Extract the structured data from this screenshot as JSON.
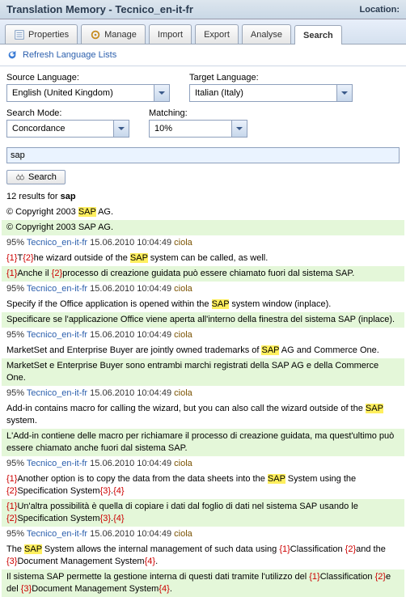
{
  "header": {
    "title": "Translation Memory - Tecnico_en-it-fr",
    "location_label": "Location:"
  },
  "tabs": {
    "properties": "Properties",
    "manage": "Manage",
    "import": "Import",
    "export": "Export",
    "analyse": "Analyse",
    "search": "Search"
  },
  "subtool": {
    "refresh": "Refresh Language Lists"
  },
  "form": {
    "source_label": "Source Language:",
    "source_value": "English (United Kingdom)",
    "target_label": "Target Language:",
    "target_value": "Italian (Italy)",
    "mode_label": "Search Mode:",
    "mode_value": "Concordance",
    "matching_label": "Matching:",
    "matching_value": "10%"
  },
  "search": {
    "value": "sap",
    "button": "Search"
  },
  "results": {
    "count_prefix": "12 results for ",
    "count_term": "sap",
    "copyright_src": "© Copyright 2003 SAP AG.",
    "copyright_tgt": "© Copyright 2003 SAP AG.",
    "meta1": {
      "pct": "95%",
      "tm": "Tecnico_en-it-fr",
      "ts": "15.06.2010 10:04:49",
      "user": "ciola"
    },
    "src1_a": "T",
    "src1_b": "he wizard outside of the ",
    "src1_c": " system can be called, as well.",
    "tgt1_a": "Anche il ",
    "tgt1_b": "processo di creazione guidata può essere chiamato fuori dal sistema SAP.",
    "meta2": {
      "pct": "95%",
      "tm": "Tecnico_en-it-fr",
      "ts": "15.06.2010 10:04:49",
      "user": "ciola"
    },
    "src2_a": "Specify if the Office application is opened within the ",
    "src2_b": " system window (inplace).",
    "tgt2": "Specificare se l'applicazione Office viene aperta all'interno della finestra del sistema SAP (inplace).",
    "meta3": {
      "pct": "95%",
      "tm": "Tecnico_en-it-fr",
      "ts": "15.06.2010 10:04:49",
      "user": "ciola"
    },
    "src3_a": "MarketSet and Enterprise Buyer are jointly owned trademarks of ",
    "src3_b": " AG and Commerce One.",
    "tgt3": "MarketSet e Enterprise Buyer sono entrambi marchi registrati della SAP AG e della Commerce One.",
    "meta4": {
      "pct": "95%",
      "tm": "Tecnico_en-it-fr",
      "ts": "15.06.2010 10:04:49",
      "user": "ciola"
    },
    "src4_a": "Add-in contains macro for calling the wizard, but you can also call the wizard outside of the ",
    "src4_b": " system.",
    "tgt4": "L'Add-in contiene delle macro per richiamare il processo di creazione guidata, ma quest'ultimo può essere chiamato anche fuori dal sistema SAP.",
    "meta5": {
      "pct": "95%",
      "tm": "Tecnico_en-it-fr",
      "ts": "15.06.2010 10:04:49",
      "user": "ciola"
    },
    "src5_a": "Another option is to copy the data from the data sheets into the ",
    "src5_b": " System using the ",
    "src5_c": "Specification System",
    "src5_d": ".",
    "tgt5_a": "Un'altra possibilità è quella di copiare i dati dal foglio di dati nel sistema SAP usando le ",
    "tgt5_b": "Specification System",
    "meta6": {
      "pct": "95%",
      "tm": "Tecnico_en-it-fr",
      "ts": "15.06.2010 10:04:49",
      "user": "ciola"
    },
    "src6_a": "The ",
    "src6_b": " System allows the internal management of such data using ",
    "src6_c": "Classification ",
    "src6_d": "and the ",
    "src6_e": "Document Management System",
    "src6_f": ".",
    "tgt6_a": "Il sistema SAP permette la gestione interna di questi dati tramite l'utilizzo del ",
    "tgt6_b": "Classification ",
    "tgt6_c": "e del ",
    "tgt6_d": "Document Management System",
    "sap": "SAP",
    "t1": "{1}",
    "t2": "{2}",
    "t3": "{3}",
    "t4": "{4}"
  }
}
